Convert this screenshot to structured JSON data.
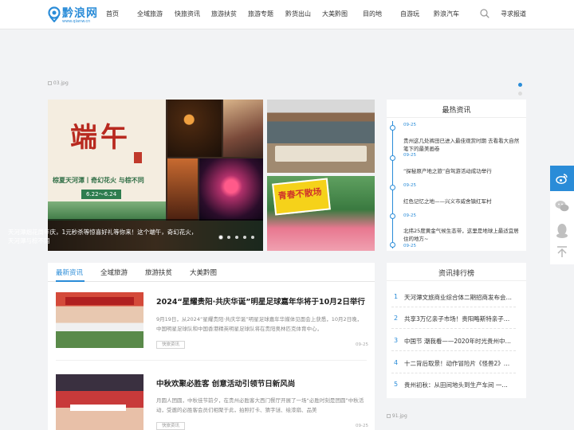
{
  "header": {
    "logo_text": "黔浪网",
    "logo_sub": "www.qlanw.cn",
    "nav": [
      "首页",
      "全域旅游",
      "快旅资讯",
      "旅游扶贫",
      "旅游专题",
      "黔货出山",
      "大美黔图",
      "目的地",
      "自游玩",
      "黔浪汽车"
    ],
    "contact": "寻求报道"
  },
  "banner": {
    "alt": "03.jpg"
  },
  "carousel": {
    "caption": "天河潭烟花周年庆，1元秒杀等惊喜好礼等你来！这个端午，奇幻花火，天河潭与棕不同",
    "slides": 5,
    "active": 1,
    "poster_title": "端午",
    "poster_line": "棕夏天河潭丨奇幻花火 与棕不同",
    "poster_date": "6.22～6.24"
  },
  "side_pics": {
    "bottom_sign": "青春不散场"
  },
  "hot_news": {
    "title": "最热资讯",
    "items": [
      {
        "date": "09-25",
        "text": ""
      },
      {
        "date": "09-25",
        "text": "贵州这几处裤田已进入最佳观赏时期 去看看大自然笔下的最美画卷"
      },
      {
        "date": "09-25",
        "text": "“探秘原产地之旅”自驾游活动成功举行"
      },
      {
        "date": "09-25",
        "text": "红色记忆之地——兴义市威舍镇红军村"
      },
      {
        "date": "09-25",
        "text": "北纬25度黄金气候生态带，这里是地球上最适宜居住的地方~"
      },
      {
        "date": "09-25",
        "text": ""
      }
    ]
  },
  "latest": {
    "tabs": [
      "最新资讯",
      "全域旅游",
      "旅游扶贫",
      "大美黔图"
    ],
    "articles": [
      {
        "title": "2024“星耀贵阳·共庆华诞”明星足球嘉年华将于10月2日举行",
        "summary": "9月19日，从2024“星耀贵阳·共庆华诞”明星足球嘉年华媒体见面会上获悉，10月2日晚，中国明星足球队和中国香港精英明星足球队将在贵阳奥林匹克体育中心，",
        "tag": "快旅资讯",
        "date": "09-25"
      },
      {
        "title": "中秋欢聚必胜客 创意活动引领节日新风尚",
        "summary": "月圆人团圆，中秋佳节前夕，在贵州必胜客大西门餐厅开展了一场“必胜时刻是团圆”中秋活动，受邀的必胜客会员们相聚于此，拍照打卡、猜字谜、绘漆扇、品美",
        "tag": "快旅资讯",
        "date": "09-25"
      }
    ]
  },
  "ranking": {
    "title": "资讯排行榜",
    "items": [
      {
        "num": "1",
        "text": "天河潭文旅商业综合体二期招商发布会盛大召开"
      },
      {
        "num": "2",
        "text": "共享3万亿亲子市场！贵阳略斯特亲子乐园正式开业"
      },
      {
        "num": "3",
        "text": "中国节 潮我看——2020年时光贵州中秋灯会"
      },
      {
        "num": "4",
        "text": "十二背后取景！动作冒险片《怪兽2》开机"
      },
      {
        "num": "5",
        "text": "贵州初秋：从田间地头到生产车间 一片繁忙"
      }
    ]
  },
  "ad": {
    "alt": "91.jpg"
  },
  "colors": {
    "accent": "#2a8cd8",
    "weibo": "#2a8cd8"
  },
  "float_icons": [
    "weibo-icon",
    "wechat-icon",
    "qq-icon",
    "back-to-top-icon"
  ]
}
